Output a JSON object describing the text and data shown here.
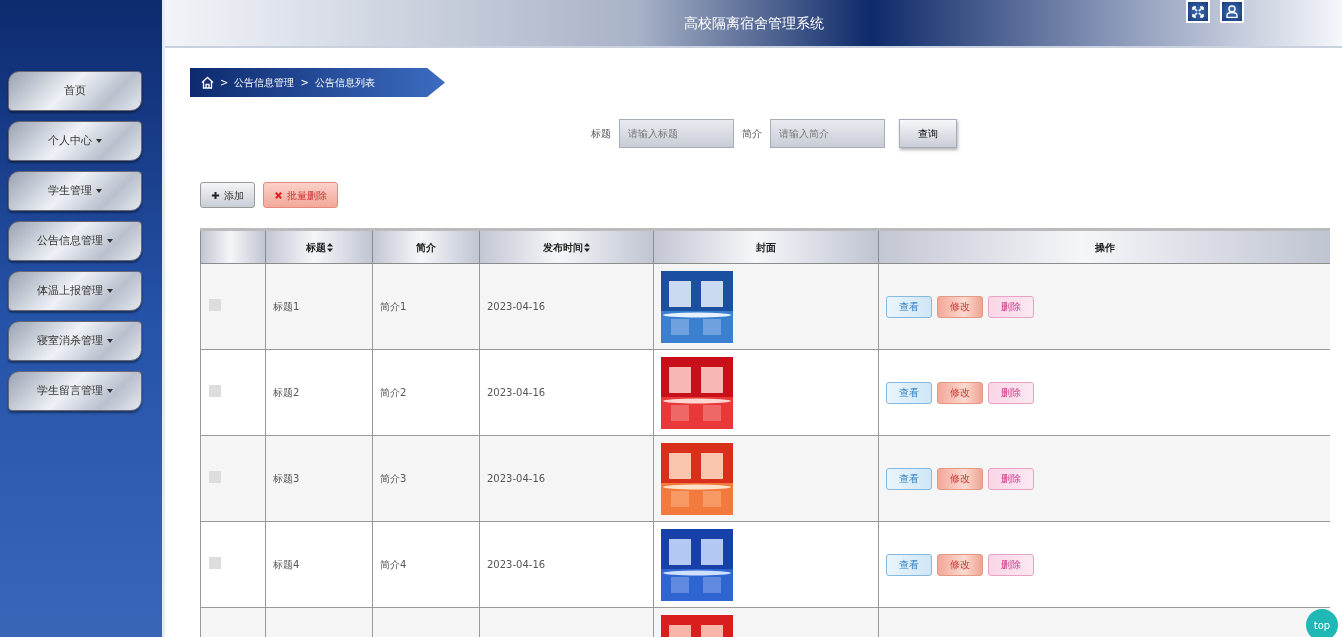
{
  "header": {
    "title": "高校隔离宿舍管理系统"
  },
  "sidebar": {
    "items": [
      {
        "label": "首页",
        "dropdown": false
      },
      {
        "label": "个人中心",
        "dropdown": true
      },
      {
        "label": "学生管理",
        "dropdown": true
      },
      {
        "label": "公告信息管理",
        "dropdown": true
      },
      {
        "label": "体温上报管理",
        "dropdown": true
      },
      {
        "label": "寝室消杀管理",
        "dropdown": true
      },
      {
        "label": "学生留言管理",
        "dropdown": true
      }
    ]
  },
  "breadcrumb": [
    {
      "separator": ">",
      "label": "公告信息管理"
    },
    {
      "separator": ">",
      "label": "公告信息列表"
    }
  ],
  "search": {
    "fields": [
      {
        "label": "标题",
        "placeholder": "请输入标题"
      },
      {
        "label": "简介",
        "placeholder": "请输入简介"
      }
    ],
    "button": "查询"
  },
  "actions": [
    {
      "label": "添加",
      "kind": "add"
    },
    {
      "label": "批量删除",
      "kind": "delete"
    }
  ],
  "table": {
    "columns": [
      {
        "label": "标题",
        "sortable": true
      },
      {
        "label": "简介",
        "sortable": false
      },
      {
        "label": "发布时间",
        "sortable": true
      },
      {
        "label": "封面",
        "sortable": false
      },
      {
        "label": "操作",
        "sortable": false
      }
    ],
    "rows": [
      {
        "checked": false,
        "title": "标题1",
        "intro": "简介1",
        "date": "2023-04-16",
        "cover": {
          "kind": "picture"
        },
        "buttons": [
          "查看",
          "修改",
          "删除"
        ]
      },
      {
        "checked": false,
        "title": "标题2",
        "intro": "简介2",
        "date": "2023-04-16",
        "cover": {
          "kind": "picture"
        },
        "buttons": [
          "查看",
          "修改",
          "删除"
        ]
      },
      {
        "checked": false,
        "title": "标题3",
        "intro": "简介3",
        "date": "2023-04-16",
        "cover": {
          "kind": "picture"
        },
        "buttons": [
          "查看",
          "修改",
          "删除"
        ]
      },
      {
        "checked": false,
        "title": "标题4",
        "intro": "简介4",
        "date": "2023-04-16",
        "cover": {
          "kind": "picture"
        },
        "buttons": [
          "查看",
          "修改",
          "删除"
        ]
      },
      {
        "cover": {
          "kind": "picture"
        }
      }
    ]
  },
  "back_to_top": {
    "label": "top"
  }
}
